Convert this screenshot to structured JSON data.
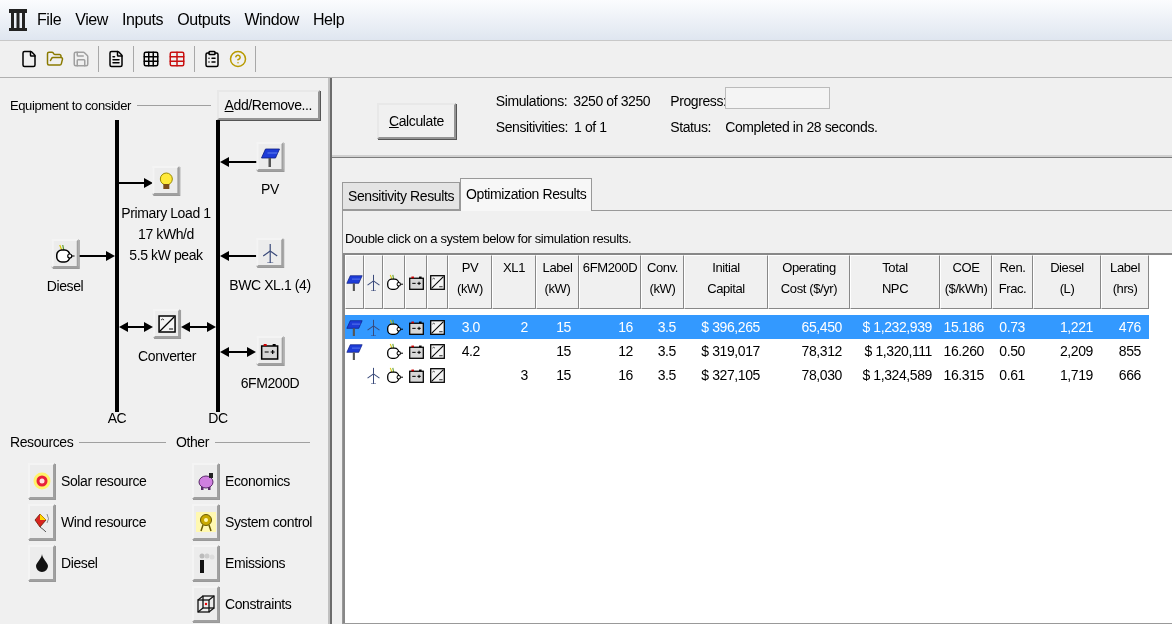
{
  "menu": {
    "items": [
      "File",
      "View",
      "Inputs",
      "Outputs",
      "Window",
      "Help"
    ]
  },
  "toolbar": [
    [
      {
        "kind": "new",
        "disabled": false
      },
      {
        "kind": "open",
        "disabled": false
      },
      {
        "kind": "save",
        "disabled": true
      }
    ],
    [
      {
        "kind": "report",
        "disabled": false
      }
    ],
    [
      {
        "kind": "grid",
        "disabled": false
      },
      {
        "kind": "costs",
        "disabled": false
      }
    ],
    [
      {
        "kind": "clipboard",
        "disabled": false
      },
      {
        "kind": "help",
        "disabled": false
      }
    ]
  ],
  "equipment": {
    "title": "Equipment to consider",
    "button": "Add/Remove...",
    "buses": [
      {
        "kind": "ac",
        "label": "AC"
      },
      {
        "kind": "dc",
        "label": "DC"
      }
    ],
    "components": [
      {
        "kind": "pv",
        "lines": [
          "PV"
        ]
      },
      {
        "kind": "load",
        "lines": [
          "Primary Load 1",
          "17 kWh/d",
          "5.5 kW peak"
        ]
      },
      {
        "kind": "diesel",
        "lines": [
          "Diesel"
        ]
      },
      {
        "kind": "wind",
        "lines": [
          "BWC XL.1 (4)"
        ]
      },
      {
        "kind": "converter",
        "lines": [
          "Converter"
        ]
      },
      {
        "kind": "battery",
        "lines": [
          "6FM200D"
        ]
      }
    ]
  },
  "resources": {
    "title": "Resources",
    "items": [
      {
        "kind": "solar",
        "label": "Solar resource"
      },
      {
        "kind": "windres",
        "label": "Wind resource"
      },
      {
        "kind": "fuel",
        "label": "Diesel"
      }
    ]
  },
  "other": {
    "title": "Other",
    "items": [
      {
        "kind": "economics",
        "label": "Economics"
      },
      {
        "kind": "control",
        "label": "System control"
      },
      {
        "kind": "emissions",
        "label": "Emissions"
      },
      {
        "kind": "constraints",
        "label": "Constraints"
      }
    ]
  },
  "calculate": {
    "button": "Calculate",
    "simulations_label": "Simulations:",
    "simulations_value": "3250 of 3250",
    "sensitivities_label": "Sensitivities:",
    "sensitivities_value": "1 of 1",
    "progress_label": "Progress:",
    "status_label": "Status:",
    "status_value": "Completed in 28 seconds."
  },
  "results": {
    "tabs": [
      {
        "label": "Sensitivity Results",
        "selected": false
      },
      {
        "label": "Optimization Results",
        "selected": true
      }
    ],
    "hint": "Double click on a system below for simulation results.",
    "table": {
      "icon_columns": [
        {
          "kind": "pv"
        },
        {
          "kind": "wind"
        },
        {
          "kind": "diesel"
        },
        {
          "kind": "battery"
        },
        {
          "kind": "converter"
        }
      ],
      "columns": [
        {
          "lines": [
            "PV",
            "(kW)"
          ]
        },
        {
          "lines": [
            "XL1"
          ]
        },
        {
          "lines": [
            "Label",
            "(kW)"
          ]
        },
        {
          "lines": [
            "6FM200D"
          ]
        },
        {
          "lines": [
            "Conv.",
            "(kW)"
          ]
        },
        {
          "lines": [
            "Initial",
            "Capital"
          ]
        },
        {
          "lines": [
            "Operating",
            "Cost ($/yr)"
          ]
        },
        {
          "lines": [
            "Total",
            "NPC"
          ]
        },
        {
          "lines": [
            "COE",
            "($/kWh)"
          ]
        },
        {
          "lines": [
            "Ren.",
            "Frac."
          ]
        },
        {
          "lines": [
            "Diesel",
            "(L)"
          ]
        },
        {
          "lines": [
            "Label",
            "(hrs)"
          ]
        }
      ],
      "rows": [
        {
          "selected": true,
          "systems": {
            "pv": true,
            "wind": true,
            "diesel": true,
            "battery": true,
            "converter": true
          },
          "cells": [
            "3.0",
            "2",
            "15",
            "16",
            "3.5",
            "$ 396,265",
            "65,450",
            "$ 1,232,939",
            "15.186",
            "0.73",
            "1,221",
            "476"
          ]
        },
        {
          "selected": false,
          "systems": {
            "pv": true,
            "wind": false,
            "diesel": true,
            "battery": true,
            "converter": true
          },
          "cells": [
            "4.2",
            null,
            "15",
            "12",
            "3.5",
            "$ 319,017",
            "78,312",
            "$ 1,320,111",
            "16.260",
            "0.50",
            "2,209",
            "855"
          ]
        },
        {
          "selected": false,
          "systems": {
            "pv": false,
            "wind": true,
            "diesel": true,
            "battery": true,
            "converter": true
          },
          "cells": [
            null,
            "3",
            "15",
            "16",
            "3.5",
            "$ 327,105",
            "78,030",
            "$ 1,324,589",
            "16.315",
            "0.61",
            "1,719",
            "666"
          ]
        }
      ]
    }
  }
}
